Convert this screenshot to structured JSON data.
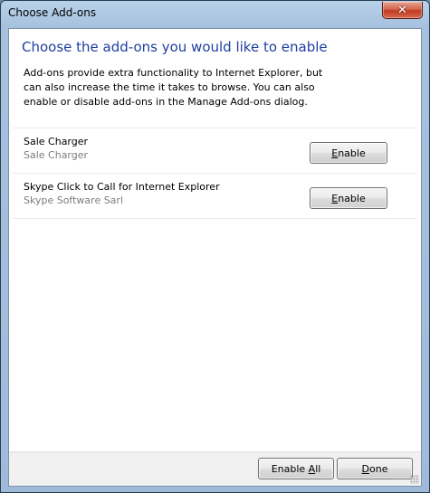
{
  "window": {
    "title": "Choose Add-ons",
    "close_glyph": "✕"
  },
  "dialog": {
    "heading": "Choose the add-ons you would like to enable",
    "description": "Add-ons provide extra functionality to Internet Explorer, but can also increase the time it takes to browse. You can also enable or disable add-ons in the Manage Add-ons dialog."
  },
  "addons": [
    {
      "name": "Sale Charger",
      "publisher": "Sale Charger",
      "button_accel": "E",
      "button_rest": "nable"
    },
    {
      "name": "Skype Click to Call for Internet Explorer",
      "publisher": "Skype Software Sarl",
      "button_accel": "E",
      "button_rest": "nable"
    }
  ],
  "footer": {
    "enable_all_prefix": "Enable ",
    "enable_all_accel": "A",
    "enable_all_rest": "ll",
    "done_accel": "D",
    "done_rest": "one"
  },
  "icons": {
    "close": "close-icon",
    "resize": "resize-grip-icon"
  },
  "colors": {
    "heading": "#1f3fa0",
    "publisher": "#7d7d7d",
    "close_button": "#c23b1f"
  }
}
